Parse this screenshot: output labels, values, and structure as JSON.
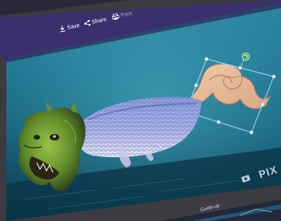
{
  "toolbar": {
    "save_label": "Save",
    "share_label": "Share",
    "print_label": "Print"
  },
  "watermark": {
    "text": "PIX"
  },
  "taskbar": {
    "guide_label": "Guide-up"
  },
  "colors": {
    "water_top": "#1f6f8a",
    "water_bottom": "#0d3e55",
    "toolbar_bg": "#3b2f6e",
    "selection": "#a9d3ff",
    "rotate_handle": "#3aa64a"
  }
}
